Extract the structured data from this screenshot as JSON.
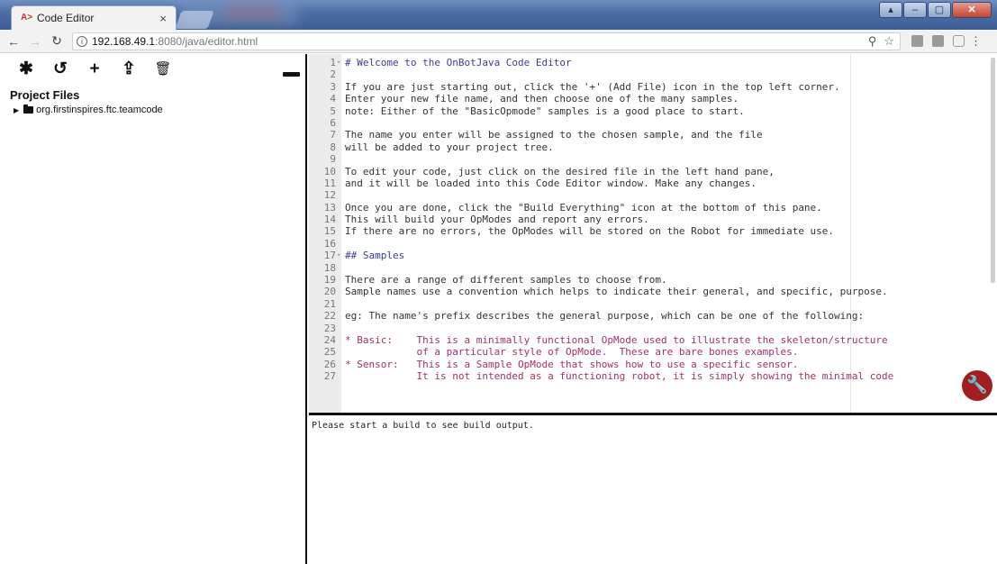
{
  "browser": {
    "tab_title": "Code Editor",
    "tab_close": "×",
    "tab_favicon": "A>",
    "url_host": "192.168.49.1",
    "url_path": ":8080/java/editor.html",
    "icons": [
      "back-icon",
      "forward-icon",
      "reload-icon",
      "info-icon",
      "zoom-icon",
      "bookmark-star-icon",
      "menu-icon"
    ]
  },
  "sidebar": {
    "tools": [
      {
        "name": "settings-icon",
        "glyph": "✱"
      },
      {
        "name": "undo-icon",
        "glyph": "↺"
      },
      {
        "name": "add-file-icon",
        "glyph": "+"
      },
      {
        "name": "upload-icon",
        "glyph": "⇪"
      },
      {
        "name": "trash-icon",
        "glyph": "🗑"
      }
    ],
    "project_title": "Project Files",
    "tree_root": "org.firstinspires.ftc.teamcode"
  },
  "editor": {
    "lines": [
      {
        "n": "1",
        "fold": "▾",
        "style": "heading",
        "text": "# Welcome to the OnBotJava Code Editor"
      },
      {
        "n": "2",
        "fold": "",
        "style": "",
        "text": ""
      },
      {
        "n": "3",
        "fold": "",
        "style": "",
        "text": "If you are just starting out, click the '+' (Add File) icon in the top left corner."
      },
      {
        "n": "4",
        "fold": "",
        "style": "",
        "text": "Enter your new file name, and then choose one of the many samples."
      },
      {
        "n": "5",
        "fold": "",
        "style": "",
        "text": "note: Either of the \"BasicOpmode\" samples is a good place to start."
      },
      {
        "n": "6",
        "fold": "",
        "style": "",
        "text": ""
      },
      {
        "n": "7",
        "fold": "",
        "style": "",
        "text": "The name you enter will be assigned to the chosen sample, and the file"
      },
      {
        "n": "8",
        "fold": "",
        "style": "",
        "text": "will be added to your project tree."
      },
      {
        "n": "9",
        "fold": "",
        "style": "",
        "text": ""
      },
      {
        "n": "10",
        "fold": "",
        "style": "",
        "text": "To edit your code, just click on the desired file in the left hand pane,"
      },
      {
        "n": "11",
        "fold": "",
        "style": "",
        "text": "and it will be loaded into this Code Editor window. Make any changes."
      },
      {
        "n": "12",
        "fold": "",
        "style": "",
        "text": ""
      },
      {
        "n": "13",
        "fold": "",
        "style": "",
        "text": "Once you are done, click the \"Build Everything\" icon at the bottom of this pane."
      },
      {
        "n": "14",
        "fold": "",
        "style": "",
        "text": "This will build your OpModes and report any errors."
      },
      {
        "n": "15",
        "fold": "",
        "style": "",
        "text": "If there are no errors, the OpModes will be stored on the Robot for immediate use."
      },
      {
        "n": "16",
        "fold": "",
        "style": "",
        "text": ""
      },
      {
        "n": "17",
        "fold": "▾",
        "style": "heading",
        "text": "## Samples"
      },
      {
        "n": "18",
        "fold": "",
        "style": "",
        "text": ""
      },
      {
        "n": "19",
        "fold": "",
        "style": "",
        "text": "There are a range of different samples to choose from."
      },
      {
        "n": "20",
        "fold": "",
        "style": "",
        "text": "Sample names use a convention which helps to indicate their general, and specific, purpose."
      },
      {
        "n": "21",
        "fold": "",
        "style": "",
        "text": ""
      },
      {
        "n": "22",
        "fold": "",
        "style": "",
        "text": "eg: The name's prefix describes the general purpose, which can be one of the following:"
      },
      {
        "n": "23",
        "fold": "",
        "style": "",
        "text": ""
      },
      {
        "n": "24",
        "fold": "",
        "style": "listing",
        "text": "* Basic:    This is a minimally functional OpMode used to illustrate the skeleton/structure"
      },
      {
        "n": "25",
        "fold": "",
        "style": "listing",
        "text": "            of a particular style of OpMode.  These are bare bones examples."
      },
      {
        "n": "26",
        "fold": "",
        "style": "listing",
        "text": "* Sensor:   This is a Sample OpMode that shows how to use a specific sensor."
      },
      {
        "n": "27",
        "fold": "",
        "style": "listing",
        "text": "            It is not intended as a functioning robot, it is simply showing the minimal code"
      }
    ]
  },
  "build": {
    "output": "Please start a build to see build output."
  },
  "wrench_icon": "🔧"
}
